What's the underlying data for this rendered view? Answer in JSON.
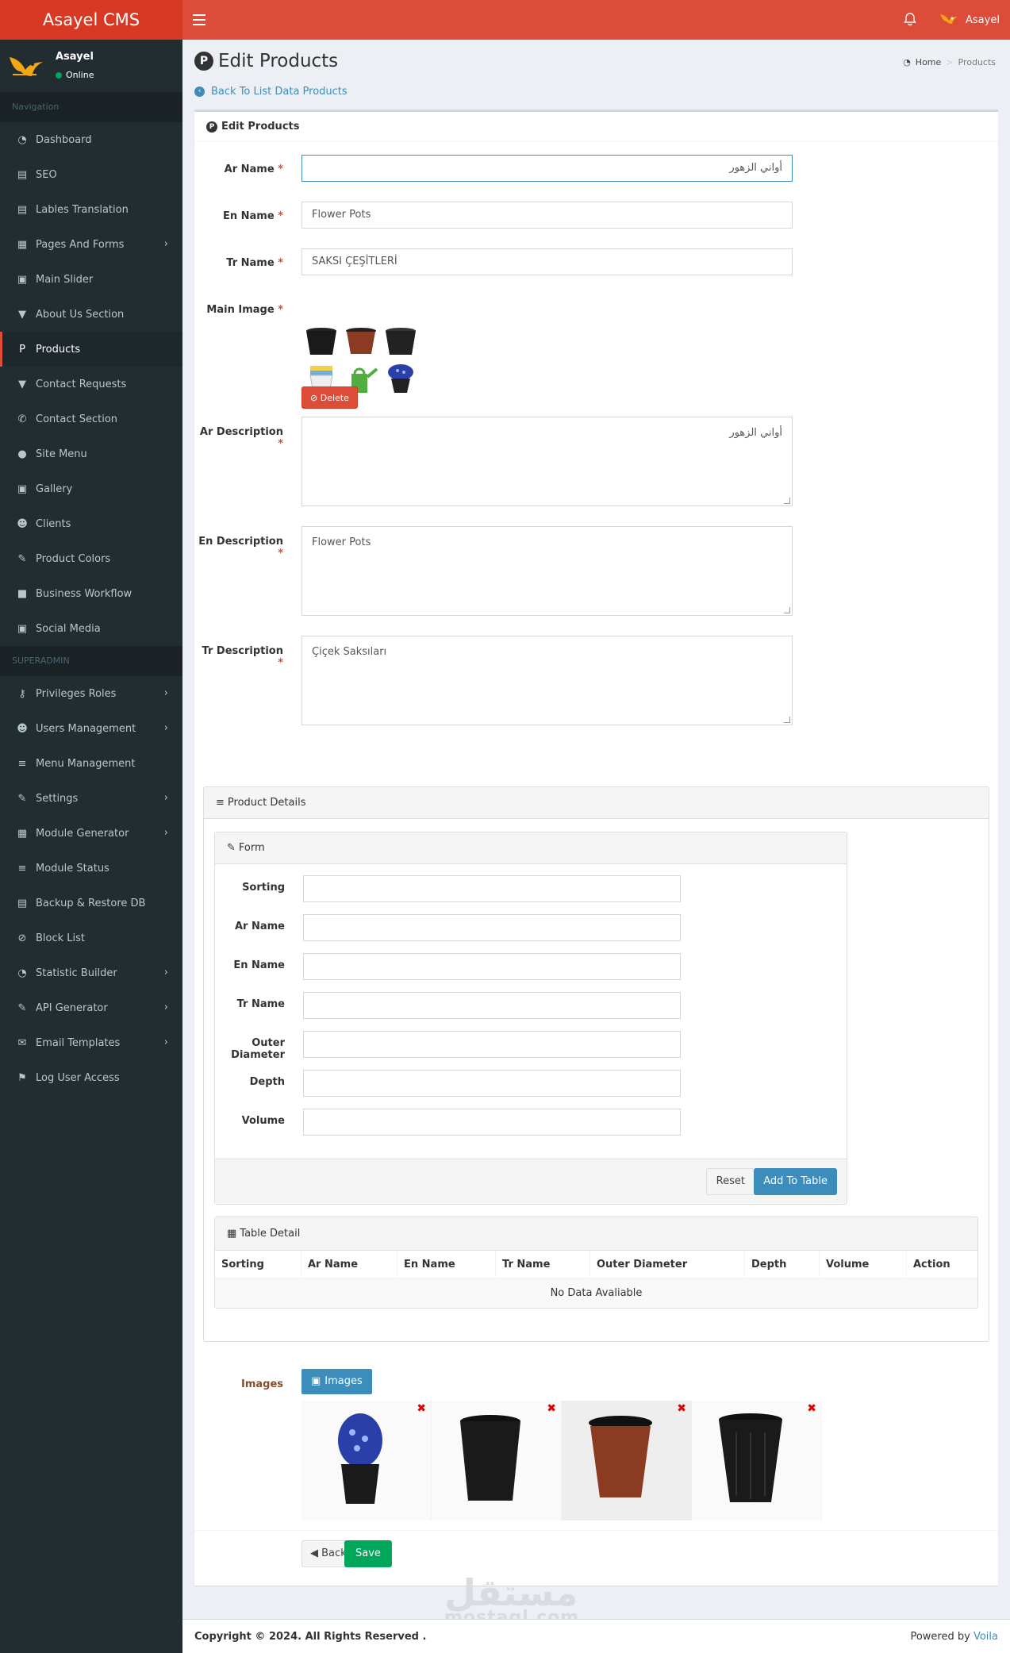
{
  "brand": {
    "title": "Asayel CMS"
  },
  "topbar": {
    "user_name": "Asayel"
  },
  "user_panel": {
    "name": "Asayel",
    "status": "Online"
  },
  "nav": {
    "header1": "Navigation",
    "header2": "SUPERADMIN",
    "items": [
      {
        "label": "Dashboard",
        "icon": "dashboard-icon",
        "glyph": "◔"
      },
      {
        "label": "SEO",
        "icon": "seo-icon",
        "glyph": "▤"
      },
      {
        "label": "Lables Translation",
        "icon": "translation-icon",
        "glyph": "▤"
      },
      {
        "label": "Pages And Forms",
        "icon": "table-icon",
        "glyph": "▦",
        "chevron": true
      },
      {
        "label": "Main Slider",
        "icon": "image-icon",
        "glyph": "▣"
      },
      {
        "label": "About Us Section",
        "icon": "filter-icon",
        "glyph": "▼"
      },
      {
        "label": "Products",
        "icon": "product-icon",
        "glyph": "P",
        "active": true
      },
      {
        "label": "Contact Requests",
        "icon": "filter-icon",
        "glyph": "▼"
      },
      {
        "label": "Contact Section",
        "icon": "phone-icon",
        "glyph": "✆"
      },
      {
        "label": "Site Menu",
        "icon": "globe-icon",
        "glyph": "●"
      },
      {
        "label": "Gallery",
        "icon": "image-icon",
        "glyph": "▣"
      },
      {
        "label": "Clients",
        "icon": "users-icon",
        "glyph": "☻"
      },
      {
        "label": "Product Colors",
        "icon": "brush-icon",
        "glyph": "✎"
      },
      {
        "label": "Business Workflow",
        "icon": "briefcase-icon",
        "glyph": "■"
      },
      {
        "label": "Social Media",
        "icon": "square-icon",
        "glyph": "▣"
      }
    ],
    "admin_items": [
      {
        "label": "Privileges Roles",
        "icon": "key-icon",
        "glyph": "⚷",
        "chevron": true
      },
      {
        "label": "Users Management",
        "icon": "users-icon",
        "glyph": "☻",
        "chevron": true
      },
      {
        "label": "Menu Management",
        "icon": "bars-icon",
        "glyph": "≡"
      },
      {
        "label": "Settings",
        "icon": "wrench-icon",
        "glyph": "✎",
        "chevron": true
      },
      {
        "label": "Module Generator",
        "icon": "grid-icon",
        "glyph": "▦",
        "chevron": true
      },
      {
        "label": "Module Status",
        "icon": "bars-icon",
        "glyph": "≡"
      },
      {
        "label": "Backup & Restore DB",
        "icon": "database-icon",
        "glyph": "▤"
      },
      {
        "label": "Block List",
        "icon": "ban-icon",
        "glyph": "⊘"
      },
      {
        "label": "Statistic Builder",
        "icon": "dashboard-icon",
        "glyph": "◔",
        "chevron": true
      },
      {
        "label": "API Generator",
        "icon": "pencil-icon",
        "glyph": "✎",
        "chevron": true
      },
      {
        "label": "Email Templates",
        "icon": "envelope-icon",
        "glyph": "✉",
        "chevron": true
      },
      {
        "label": "Log User Access",
        "icon": "flag-icon",
        "glyph": "⚑"
      }
    ]
  },
  "page": {
    "title": "Edit Products",
    "breadcrumb_home": "Home",
    "breadcrumb_current": "Products",
    "back_link": "Back To List Data Products"
  },
  "form": {
    "box_title": "Edit Products",
    "ar_name_label": "Ar Name",
    "ar_name_value": "أواني الزهور",
    "en_name_label": "En Name",
    "en_name_value": "Flower Pots",
    "tr_name_label": "Tr Name",
    "tr_name_value": "SAKSI ÇEŞİTLERİ",
    "main_image_label": "Main Image",
    "delete_label": "Delete",
    "ar_desc_label": "Ar Description",
    "ar_desc_value": "أواني الزهور",
    "en_desc_label": "En Description",
    "en_desc_value": "Flower Pots",
    "tr_desc_label": "Tr Description",
    "tr_desc_value": "Çiçek Saksıları",
    "required_mark": "*"
  },
  "product_details": {
    "title": "Product Details",
    "form_title": "Form",
    "fields": [
      {
        "label": "Sorting",
        "value": ""
      },
      {
        "label": "Ar Name",
        "value": ""
      },
      {
        "label": "En Name",
        "value": ""
      },
      {
        "label": "Tr Name",
        "value": ""
      },
      {
        "label": "Outer Diameter",
        "value": ""
      },
      {
        "label": "Depth",
        "value": ""
      },
      {
        "label": "Volume",
        "value": ""
      }
    ],
    "reset_label": "Reset",
    "add_label": "Add To Table",
    "table_title": "Table Detail",
    "columns": [
      "Sorting",
      "Ar Name",
      "En Name",
      "Tr Name",
      "Outer Diameter",
      "Depth",
      "Volume",
      "Action"
    ],
    "empty_text": "No Data Avaliable"
  },
  "images": {
    "label": "Images",
    "button_label": "Images",
    "remove_mark": "✖"
  },
  "actions": {
    "back_label": "Back",
    "save_label": "Save"
  },
  "watermark": {
    "arabic": "مستقل",
    "latin": "mostaql.com"
  },
  "footer": {
    "copyright": "Copyright © 2024. All Rights Reserved .",
    "powered_prefix": "Powered by",
    "powered_link": "Voila"
  },
  "colors": {
    "header": "#dd4b39",
    "sidebar": "#222d32",
    "primary": "#3c8dbc",
    "success": "#00a65a",
    "danger": "#dd4b39"
  }
}
